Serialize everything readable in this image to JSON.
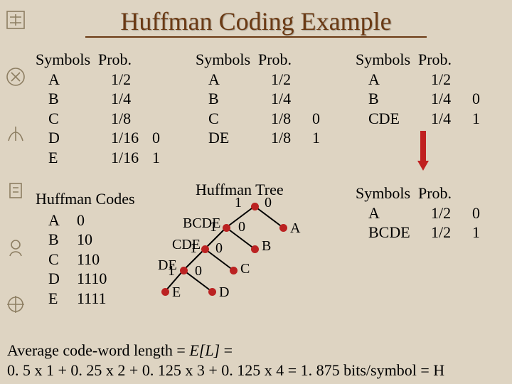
{
  "title": "Huffman Coding Example",
  "hdr": {
    "sym": "Symbols",
    "prob": "Prob."
  },
  "step1": {
    "rows": [
      {
        "s": "A",
        "p": "1/2",
        "b": ""
      },
      {
        "s": "B",
        "p": "1/4",
        "b": ""
      },
      {
        "s": "C",
        "p": "1/8",
        "b": ""
      },
      {
        "s": "D",
        "p": "1/16",
        "b": "0"
      },
      {
        "s": "E",
        "p": "1/16",
        "b": "1"
      }
    ]
  },
  "step2": {
    "rows": [
      {
        "s": "A",
        "p": "1/2",
        "b": ""
      },
      {
        "s": "B",
        "p": "1/4",
        "b": ""
      },
      {
        "s": "C",
        "p": "1/8",
        "b": "0"
      },
      {
        "s": "DE",
        "p": "1/8",
        "b": "1"
      }
    ]
  },
  "step3": {
    "rows": [
      {
        "s": "A",
        "p": "1/2",
        "b": ""
      },
      {
        "s": "B",
        "p": "1/4",
        "b": "0"
      },
      {
        "s": "CDE",
        "p": "1/4",
        "b": "1"
      }
    ]
  },
  "step4": {
    "rows": [
      {
        "s": "A",
        "p": "1/2",
        "b": "0"
      },
      {
        "s": "BCDE",
        "p": "1/2",
        "b": "1"
      }
    ]
  },
  "codes_title": "Huffman Codes",
  "codes": [
    {
      "s": "A",
      "c": "0"
    },
    {
      "s": "B",
      "c": "10"
    },
    {
      "s": "C",
      "c": "110"
    },
    {
      "s": "D",
      "c": "1110"
    },
    {
      "s": "E",
      "c": "1111"
    }
  ],
  "tree_title": "Huffman Tree",
  "tree": {
    "labels": {
      "bcde": "BCDE",
      "cde": "CDE",
      "de": "DE",
      "a": "A",
      "b": "B",
      "c": "C",
      "d": "D",
      "e": "E",
      "one": "1",
      "zero": "0"
    }
  },
  "footer": {
    "l1a": "Average code-word length = ",
    "l1b": "E[L]",
    "l1c": " =",
    "l2a": "0. 5 x 1 + 0. 25 x 2 + 0. 125 x 3 + 0. 125 x 4 = 1. 875 bits/symbol  = H"
  }
}
